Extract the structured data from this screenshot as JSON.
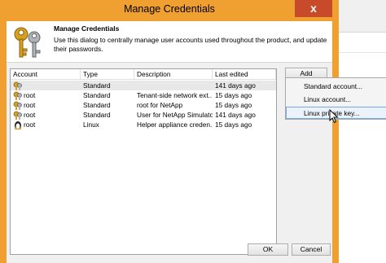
{
  "window": {
    "title": "Manage Credentials",
    "close_glyph": "x"
  },
  "header": {
    "title": "Manage Credentials",
    "description": "Use this dialog to centrally manage user accounts used throughout the product, and update their passwords.",
    "icon": "keys-icon"
  },
  "grid": {
    "columns": [
      "Account",
      "Type",
      "Description",
      "Last edited"
    ],
    "rows": [
      {
        "account": "",
        "type": "Standard",
        "description": "",
        "last_edited": "141 days ago",
        "icon": "key-icon",
        "selected": true
      },
      {
        "account": "root",
        "type": "Standard",
        "description": "Tenant-side network ext...",
        "last_edited": "15 days ago",
        "icon": "key-icon"
      },
      {
        "account": "root",
        "type": "Standard",
        "description": "root for NetApp",
        "last_edited": "15 days ago",
        "icon": "key-icon"
      },
      {
        "account": "root",
        "type": "Standard",
        "description": "User for NetApp Simulator",
        "last_edited": "141 days ago",
        "icon": "key-icon"
      },
      {
        "account": "root",
        "type": "Linux",
        "description": "Helper appliance creden...",
        "last_edited": "15 days ago",
        "icon": "linux-penguin-icon"
      }
    ]
  },
  "buttons": {
    "add": "Add",
    "ok": "OK",
    "cancel": "Cancel"
  },
  "menu": {
    "items": [
      "Standard account...",
      "Linux account...",
      "Linux private key..."
    ],
    "hovered_index": 2
  },
  "colors": {
    "title_bar": "#f0a030",
    "close_button": "#c74a2a",
    "menu_hover": "#eaf2fb"
  }
}
